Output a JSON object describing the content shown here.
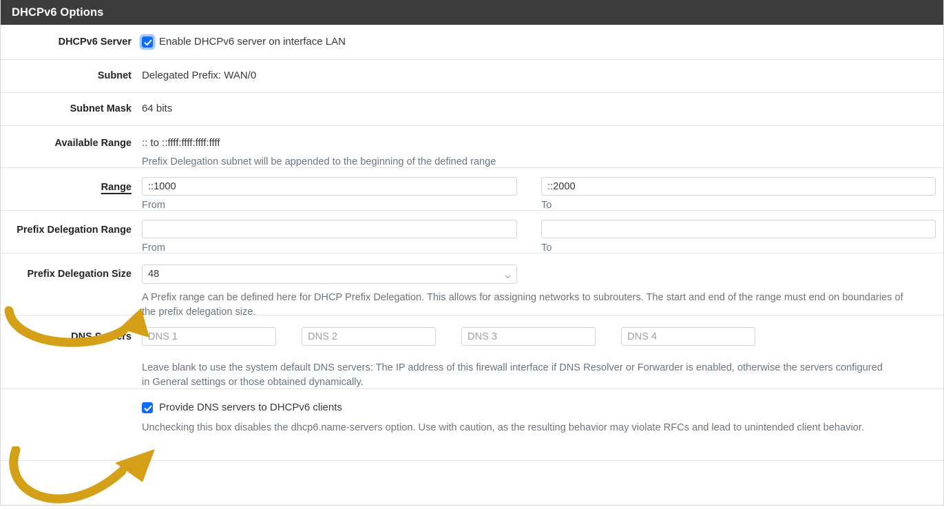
{
  "header": {
    "title": "DHCPv6 Options"
  },
  "colors": {
    "header_bg": "#3c3c3c",
    "accent_checkbox": "#0d6efd",
    "annotation_arrow": "#d3a017",
    "divider": "#e4e4e4",
    "help_text": "#6c757d"
  },
  "rows": {
    "dhcpv6_server": {
      "label": "DHCPv6 Server",
      "checkbox_label": "Enable DHCPv6 server on interface LAN",
      "checked": true,
      "focused": true
    },
    "subnet": {
      "label": "Subnet",
      "value": "Delegated Prefix: WAN/0"
    },
    "subnet_mask": {
      "label": "Subnet Mask",
      "value": "64 bits"
    },
    "available_range": {
      "label": "Available Range",
      "value": ":: to ::ffff:ffff:ffff:ffff",
      "help": "Prefix Delegation subnet will be appended to the beginning of the defined range"
    },
    "range": {
      "label": "Range",
      "from_value": "::1000",
      "from_sub_label": "From",
      "to_value": "::2000",
      "to_sub_label": "To"
    },
    "prefix_delegation_range": {
      "label": "Prefix Delegation Range",
      "from_value": "",
      "from_sub_label": "From",
      "to_value": "",
      "to_sub_label": "To"
    },
    "prefix_delegation_size": {
      "label": "Prefix Delegation Size",
      "selected": "48",
      "options": [
        "48"
      ],
      "help": "A Prefix range can be defined here for DHCP Prefix Delegation. This allows for assigning networks to subrouters. The start and end of the range must end on boundaries of the prefix delegation size."
    },
    "dns_servers": {
      "label": "DNS Servers",
      "inputs": [
        {
          "placeholder": "DNS 1",
          "value": ""
        },
        {
          "placeholder": "DNS 2",
          "value": ""
        },
        {
          "placeholder": "DNS 3",
          "value": ""
        },
        {
          "placeholder": "DNS 4",
          "value": ""
        }
      ],
      "help": "Leave blank to use the system default DNS servers: The IP address of this firewall interface if DNS Resolver or Forwarder is enabled, otherwise the servers configured in General settings or those obtained dynamically."
    },
    "provide_dns": {
      "checkbox_label": "Provide DNS servers to DHCPv6 clients",
      "checked": true,
      "focused": false,
      "help": "Unchecking this box disables the dhcp6.name-servers option. Use with caution, as the resulting behavior may violate RFCs and lead to unintended client behavior."
    }
  },
  "annotations": [
    {
      "name": "arrow-to-prefix-delegation-size",
      "target": "Prefix Delegation Size dropdown"
    },
    {
      "name": "arrow-to-provide-dns-checkbox",
      "target": "Provide DNS servers to DHCPv6 clients checkbox"
    }
  ]
}
